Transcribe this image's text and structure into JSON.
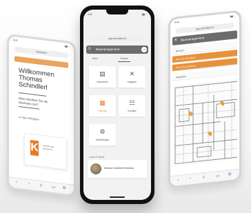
{
  "left_phone": {
    "status_time": "9:41",
    "url": "Anmelden",
    "welcome": "Willkommen\nThomas\nSchindlerl",
    "question": "Was möchten Sie als\nNächstes tun?",
    "link": "In App einloggen",
    "card_text": "KHAMA app\nIntegration",
    "logo_letter": "K"
  },
  "center_phone": {
    "status_time": "9:41",
    "url": "app.schindlerl.ch",
    "header_title": "Baumanagement",
    "avatar": "TS",
    "tabs": [
      "Menü",
      "Projekte"
    ],
    "tiles": [
      {
        "label": "Dokumente",
        "icon": "document-icon"
      },
      {
        "label": "Aufgaben",
        "icon": "tools-icon"
      },
      {
        "label": "Planung",
        "icon": "plan-icon"
      },
      {
        "label": "Kontakte",
        "icon": "contacts-icon"
      },
      {
        "label": "Einstellungen",
        "icon": "settings-icon"
      }
    ],
    "section_label": "Letzte Projekte",
    "project_name": "Neubau Schindlerl Wohnbau"
  },
  "right_phone": {
    "status_time": "9:41",
    "url": "app.schindlerl.ch",
    "header_title": "Baumanagement",
    "rows": [
      {
        "text": "Bereich"
      },
      {
        "text": "Plan EG Grundriss",
        "highlight": true
      },
      {
        "text": "Plan OG Grundriss",
        "highlight": true
      },
      {
        "text": "Aufgaben"
      }
    ],
    "pin_count": 3
  },
  "colors": {
    "accent_orange": "#e8913c",
    "header_grey": "#6c6c6c",
    "phone_black": "#111111"
  }
}
